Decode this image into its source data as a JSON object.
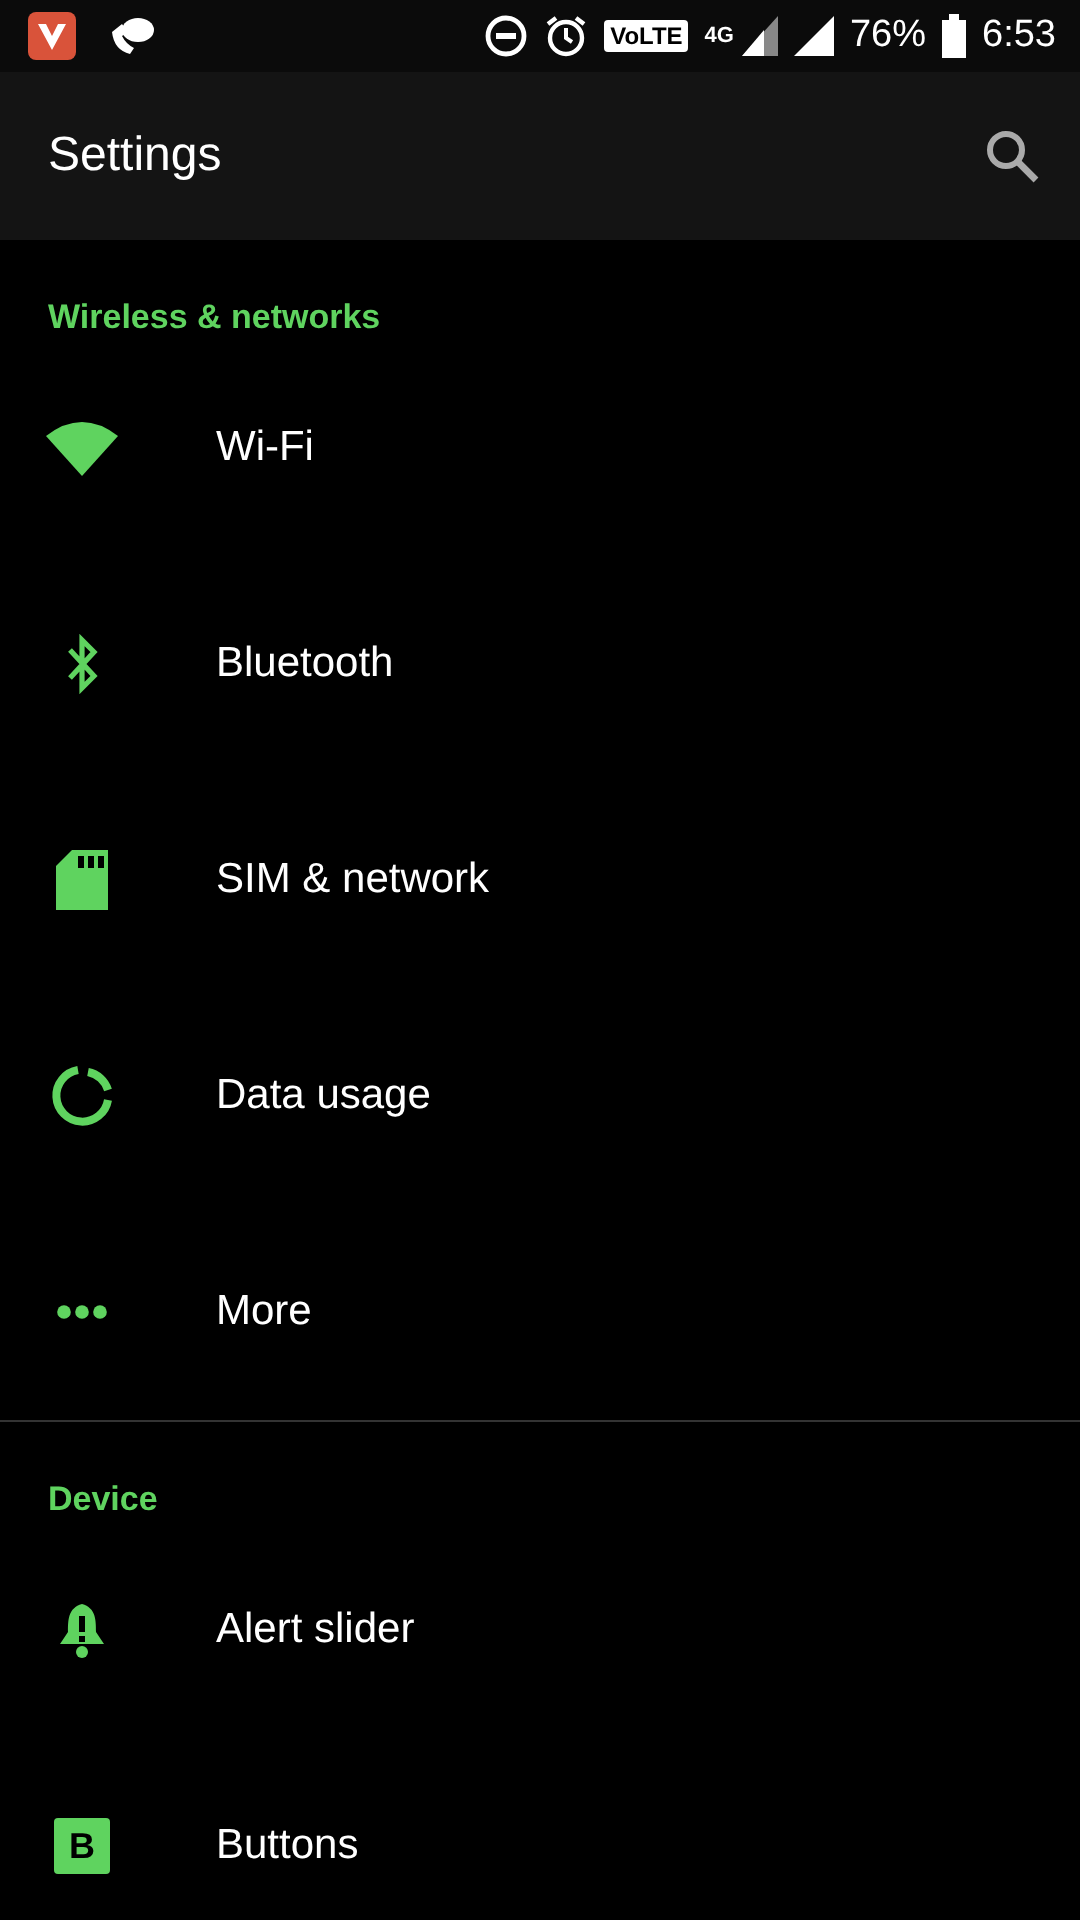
{
  "status_bar": {
    "volte": "VoLTE",
    "network": "4G",
    "battery": "76%",
    "time": "6:53"
  },
  "toolbar": {
    "title": "Settings"
  },
  "sections": [
    {
      "header": "Wireless & networks",
      "items": [
        {
          "label": "Wi-Fi"
        },
        {
          "label": "Bluetooth"
        },
        {
          "label": "SIM & network"
        },
        {
          "label": "Data usage"
        },
        {
          "label": "More"
        }
      ]
    },
    {
      "header": "Device",
      "items": [
        {
          "label": "Alert slider"
        },
        {
          "label": "Buttons",
          "badge": "B"
        }
      ]
    }
  ]
}
